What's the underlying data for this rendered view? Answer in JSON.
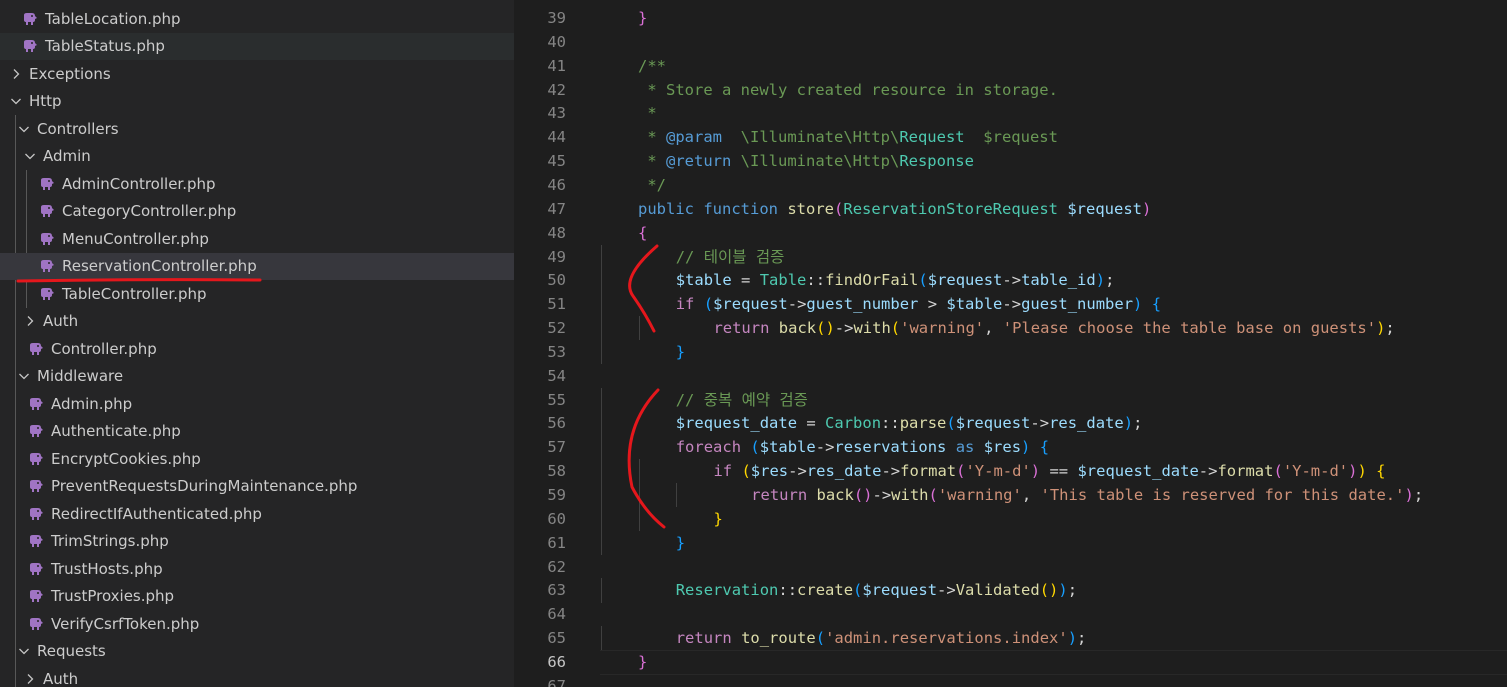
{
  "explorer": {
    "rows": [
      {
        "label": "TableLocation.php",
        "kind": "file",
        "depth": 1
      },
      {
        "label": "TableStatus.php",
        "kind": "file",
        "depth": 1,
        "state": "hover"
      },
      {
        "label": "Exceptions",
        "kind": "folder-closed",
        "depth": 0
      },
      {
        "label": "Http",
        "kind": "folder-open",
        "depth": 0
      },
      {
        "label": "Controllers",
        "kind": "folder-open",
        "depth": 1
      },
      {
        "label": "Admin",
        "kind": "folder-open",
        "depth": 2
      },
      {
        "label": "AdminController.php",
        "kind": "file",
        "depth": 3
      },
      {
        "label": "CategoryController.php",
        "kind": "file",
        "depth": 3
      },
      {
        "label": "MenuController.php",
        "kind": "file",
        "depth": 3
      },
      {
        "label": "ReservationController.php",
        "kind": "file",
        "depth": 3,
        "state": "selected"
      },
      {
        "label": "TableController.php",
        "kind": "file",
        "depth": 3
      },
      {
        "label": "Auth",
        "kind": "folder-closed",
        "depth": 2
      },
      {
        "label": "Controller.php",
        "kind": "file",
        "depth": 2
      },
      {
        "label": "Middleware",
        "kind": "folder-open",
        "depth": 1
      },
      {
        "label": "Admin.php",
        "kind": "file",
        "depth": 2
      },
      {
        "label": "Authenticate.php",
        "kind": "file",
        "depth": 2
      },
      {
        "label": "EncryptCookies.php",
        "kind": "file",
        "depth": 2
      },
      {
        "label": "PreventRequestsDuringMaintenance.php",
        "kind": "file",
        "depth": 2
      },
      {
        "label": "RedirectIfAuthenticated.php",
        "kind": "file",
        "depth": 2
      },
      {
        "label": "TrimStrings.php",
        "kind": "file",
        "depth": 2
      },
      {
        "label": "TrustHosts.php",
        "kind": "file",
        "depth": 2
      },
      {
        "label": "TrustProxies.php",
        "kind": "file",
        "depth": 2
      },
      {
        "label": "VerifyCsrfToken.php",
        "kind": "file",
        "depth": 2
      },
      {
        "label": "Requests",
        "kind": "folder-open",
        "depth": 1
      },
      {
        "label": "Auth",
        "kind": "folder-closed",
        "depth": 2
      }
    ]
  },
  "editor": {
    "active_line": "66",
    "lines": [
      {
        "n": "39",
        "indent": 1,
        "tokens": [
          [
            "}",
            "b2"
          ]
        ]
      },
      {
        "n": "40",
        "indent": 0,
        "tokens": []
      },
      {
        "n": "41",
        "indent": 1,
        "tokens": [
          [
            "/**",
            "t-cmt"
          ]
        ]
      },
      {
        "n": "42",
        "indent": 1,
        "tokens": [
          [
            " * Store a newly created resource in storage.",
            "t-cmt"
          ]
        ]
      },
      {
        "n": "43",
        "indent": 1,
        "tokens": [
          [
            " *",
            "t-cmt"
          ]
        ]
      },
      {
        "n": "44",
        "indent": 1,
        "tokens": [
          [
            " * ",
            "t-cmt"
          ],
          [
            "@param",
            "t-doc"
          ],
          [
            "  \\Illuminate\\Http\\",
            "t-cmt"
          ],
          [
            "Request",
            "t-cls"
          ],
          [
            "  $request",
            "t-cmt"
          ]
        ]
      },
      {
        "n": "45",
        "indent": 1,
        "tokens": [
          [
            " * ",
            "t-cmt"
          ],
          [
            "@return",
            "t-doc"
          ],
          [
            " \\Illuminate\\Http\\",
            "t-cmt"
          ],
          [
            "Response",
            "t-cls"
          ]
        ]
      },
      {
        "n": "46",
        "indent": 1,
        "tokens": [
          [
            " */",
            "t-cmt"
          ]
        ]
      },
      {
        "n": "47",
        "indent": 1,
        "tokens": [
          [
            "public",
            "t-kw"
          ],
          [
            " ",
            "t-op"
          ],
          [
            "function",
            "t-kw"
          ],
          [
            " ",
            "t-op"
          ],
          [
            "store",
            "t-fn"
          ],
          [
            "(",
            "b2"
          ],
          [
            "ReservationStoreRequest",
            "t-cls"
          ],
          [
            " ",
            "t-op"
          ],
          [
            "$request",
            "t-var"
          ],
          [
            ")",
            "b2"
          ]
        ]
      },
      {
        "n": "48",
        "indent": 1,
        "tokens": [
          [
            "{",
            "b2"
          ]
        ]
      },
      {
        "n": "49",
        "indent": 2,
        "tokens": [
          [
            "// 테이블 검증",
            "t-cmt"
          ]
        ]
      },
      {
        "n": "50",
        "indent": 2,
        "tokens": [
          [
            "$table",
            "t-var"
          ],
          [
            " = ",
            "t-op"
          ],
          [
            "Table",
            "t-cls"
          ],
          [
            "::",
            "t-op"
          ],
          [
            "findOrFail",
            "t-fn"
          ],
          [
            "(",
            "b3"
          ],
          [
            "$request",
            "t-var"
          ],
          [
            "->",
            "t-op"
          ],
          [
            "table_id",
            "t-var"
          ],
          [
            ")",
            "b3"
          ],
          [
            ";",
            "t-op"
          ]
        ]
      },
      {
        "n": "51",
        "indent": 2,
        "tokens": [
          [
            "if",
            "t-ctl"
          ],
          [
            " ",
            "t-op"
          ],
          [
            "(",
            "b3"
          ],
          [
            "$request",
            "t-var"
          ],
          [
            "->",
            "t-op"
          ],
          [
            "guest_number",
            "t-var"
          ],
          [
            " > ",
            "t-op"
          ],
          [
            "$table",
            "t-var"
          ],
          [
            "->",
            "t-op"
          ],
          [
            "guest_number",
            "t-var"
          ],
          [
            ")",
            "b3"
          ],
          [
            " ",
            "t-op"
          ],
          [
            "{",
            "b3"
          ]
        ]
      },
      {
        "n": "52",
        "indent": 3,
        "tokens": [
          [
            "return",
            "t-ctl"
          ],
          [
            " ",
            "t-op"
          ],
          [
            "back",
            "t-fn"
          ],
          [
            "()",
            "b1"
          ],
          [
            "->",
            "t-op"
          ],
          [
            "with",
            "t-fn"
          ],
          [
            "(",
            "b1"
          ],
          [
            "'warning'",
            "t-str"
          ],
          [
            ", ",
            "t-op"
          ],
          [
            "'Please choose the table base on guests'",
            "t-str"
          ],
          [
            ")",
            "b1"
          ],
          [
            ";",
            "t-op"
          ]
        ]
      },
      {
        "n": "53",
        "indent": 2,
        "tokens": [
          [
            "}",
            "b3"
          ]
        ]
      },
      {
        "n": "54",
        "indent": 0,
        "tokens": []
      },
      {
        "n": "55",
        "indent": 2,
        "tokens": [
          [
            "// 중복 예약 검증",
            "t-cmt"
          ]
        ]
      },
      {
        "n": "56",
        "indent": 2,
        "tokens": [
          [
            "$request_date",
            "t-var"
          ],
          [
            " = ",
            "t-op"
          ],
          [
            "Carbon",
            "t-cls"
          ],
          [
            "::",
            "t-op"
          ],
          [
            "parse",
            "t-fn"
          ],
          [
            "(",
            "b3"
          ],
          [
            "$request",
            "t-var"
          ],
          [
            "->",
            "t-op"
          ],
          [
            "res_date",
            "t-var"
          ],
          [
            ")",
            "b3"
          ],
          [
            ";",
            "t-op"
          ]
        ]
      },
      {
        "n": "57",
        "indent": 2,
        "tokens": [
          [
            "foreach",
            "t-ctl"
          ],
          [
            " ",
            "t-op"
          ],
          [
            "(",
            "b3"
          ],
          [
            "$table",
            "t-var"
          ],
          [
            "->",
            "t-op"
          ],
          [
            "reservations",
            "t-var"
          ],
          [
            " as ",
            "t-kw"
          ],
          [
            "$res",
            "t-var"
          ],
          [
            ")",
            "b3"
          ],
          [
            " ",
            "t-op"
          ],
          [
            "{",
            "b3"
          ]
        ]
      },
      {
        "n": "58",
        "indent": 3,
        "tokens": [
          [
            "if",
            "t-ctl"
          ],
          [
            " ",
            "t-op"
          ],
          [
            "(",
            "b1"
          ],
          [
            "$res",
            "t-var"
          ],
          [
            "->",
            "t-op"
          ],
          [
            "res_date",
            "t-var"
          ],
          [
            "->",
            "t-op"
          ],
          [
            "format",
            "t-fn"
          ],
          [
            "(",
            "b2"
          ],
          [
            "'Y-m-d'",
            "t-str"
          ],
          [
            ")",
            "b2"
          ],
          [
            " == ",
            "t-op"
          ],
          [
            "$request_date",
            "t-var"
          ],
          [
            "->",
            "t-op"
          ],
          [
            "format",
            "t-fn"
          ],
          [
            "(",
            "b2"
          ],
          [
            "'Y-m-d'",
            "t-str"
          ],
          [
            ")",
            "b2"
          ],
          [
            ")",
            "b1"
          ],
          [
            " ",
            "t-op"
          ],
          [
            "{",
            "b1"
          ]
        ]
      },
      {
        "n": "59",
        "indent": 4,
        "tokens": [
          [
            "return",
            "t-ctl"
          ],
          [
            " ",
            "t-op"
          ],
          [
            "back",
            "t-fn"
          ],
          [
            "()",
            "b2"
          ],
          [
            "->",
            "t-op"
          ],
          [
            "with",
            "t-fn"
          ],
          [
            "(",
            "b2"
          ],
          [
            "'warning'",
            "t-str"
          ],
          [
            ", ",
            "t-op"
          ],
          [
            "'This table is reserved for this date.'",
            "t-str"
          ],
          [
            ")",
            "b2"
          ],
          [
            ";",
            "t-op"
          ]
        ]
      },
      {
        "n": "60",
        "indent": 3,
        "tokens": [
          [
            "}",
            "b1"
          ]
        ]
      },
      {
        "n": "61",
        "indent": 2,
        "tokens": [
          [
            "}",
            "b3"
          ]
        ]
      },
      {
        "n": "62",
        "indent": 0,
        "tokens": []
      },
      {
        "n": "63",
        "indent": 2,
        "tokens": [
          [
            "Reservation",
            "t-cls"
          ],
          [
            "::",
            "t-op"
          ],
          [
            "create",
            "t-fn"
          ],
          [
            "(",
            "b3"
          ],
          [
            "$request",
            "t-var"
          ],
          [
            "->",
            "t-op"
          ],
          [
            "Validated",
            "t-fn"
          ],
          [
            "()",
            "b1"
          ],
          [
            ")",
            "b3"
          ],
          [
            ";",
            "t-op"
          ]
        ]
      },
      {
        "n": "64",
        "indent": 0,
        "tokens": []
      },
      {
        "n": "65",
        "indent": 2,
        "tokens": [
          [
            "return",
            "t-ctl"
          ],
          [
            " ",
            "t-op"
          ],
          [
            "to_route",
            "t-fn"
          ],
          [
            "(",
            "b3"
          ],
          [
            "'admin.reservations.index'",
            "t-str"
          ],
          [
            ")",
            "b3"
          ],
          [
            ";",
            "t-op"
          ]
        ]
      },
      {
        "n": "66",
        "indent": 1,
        "tokens": [
          [
            "}",
            "b2"
          ]
        ]
      },
      {
        "n": "67",
        "indent": 0,
        "tokens": []
      }
    ]
  },
  "colors": {
    "annotation_red": "#e5171c",
    "php_icon": "#a074c4"
  }
}
